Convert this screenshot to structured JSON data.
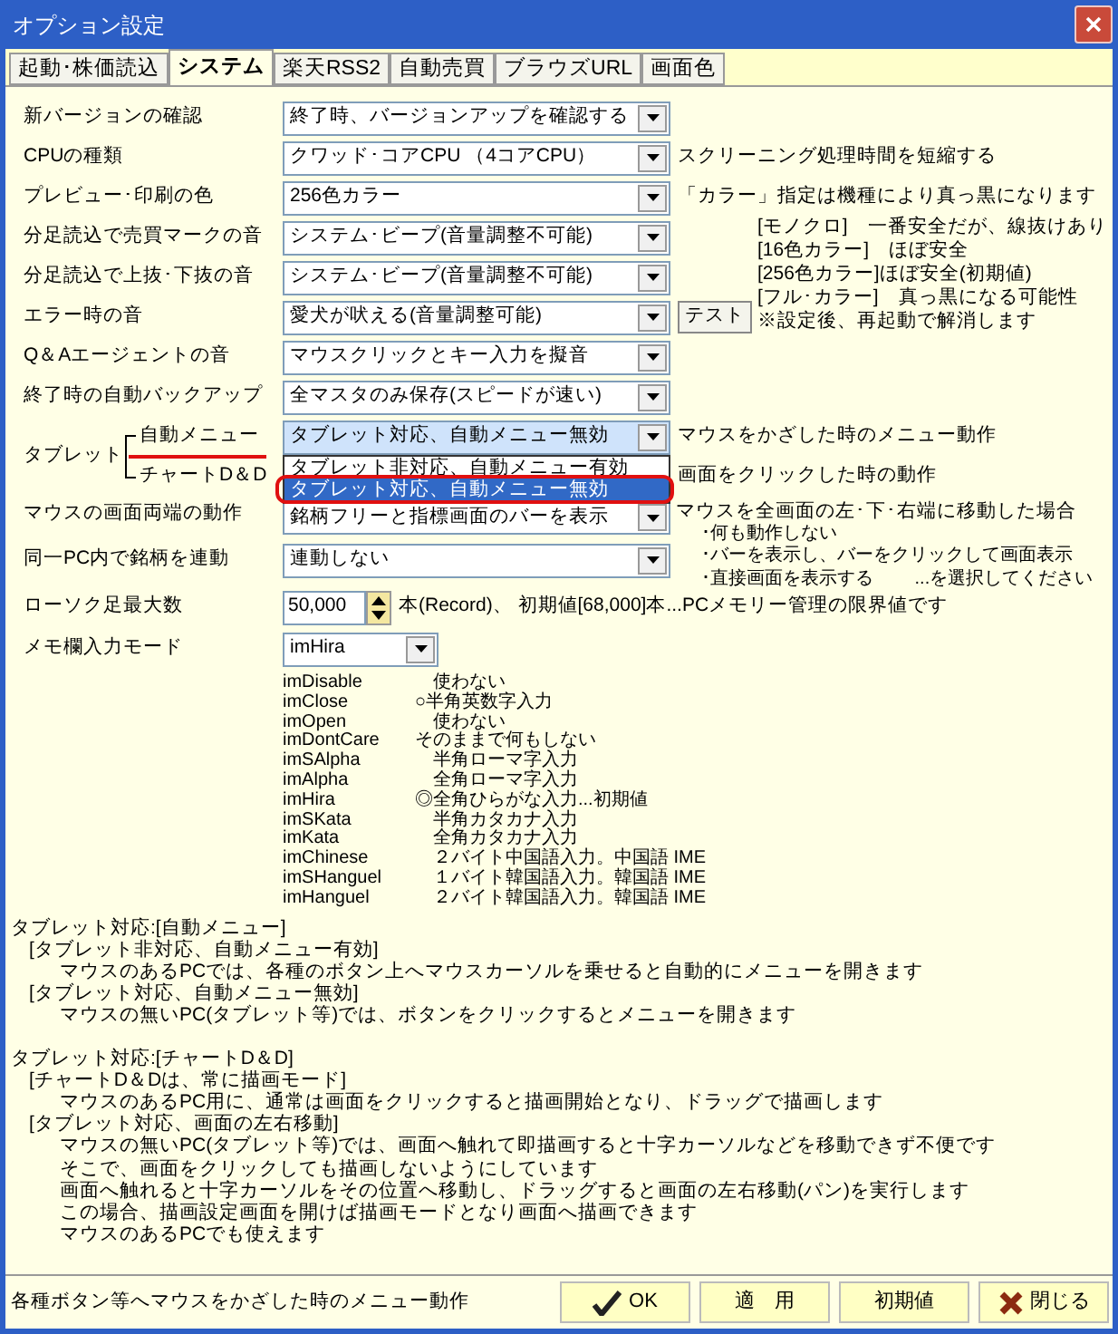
{
  "window": {
    "title": "オプション設定"
  },
  "tabs": [
    {
      "label": "起動･株価読込",
      "selected": false
    },
    {
      "label": "システム",
      "selected": true
    },
    {
      "label": "楽天RSS2",
      "selected": false
    },
    {
      "label": "自動売買",
      "selected": false
    },
    {
      "label": "ブラウズURL",
      "selected": false
    },
    {
      "label": "画面色",
      "selected": false
    }
  ],
  "settings": [
    {
      "label": "新バージョンの確認",
      "value": "終了時、バージョンアップを確認する"
    },
    {
      "label": "CPUの種類",
      "value": "クワッド･コアCPU （4コアCPU）",
      "note": "スクリーニング処理時間を短縮する"
    },
    {
      "label": "プレビュー･印刷の色",
      "value": "256色カラー",
      "note": "「カラー」指定は機種により真っ黒になります"
    }
  ],
  "sound_group": {
    "rows": [
      {
        "label": "分足読込で売買マークの音",
        "value": "システム･ビープ(音量調整不可能)"
      },
      {
        "label": "分足読込で上抜･下抜の音",
        "value": "システム･ビープ(音量調整不可能)"
      },
      {
        "label": "エラー時の音",
        "value": "愛犬が吠える(音量調整可能)",
        "button": "テスト"
      }
    ],
    "note_lines": [
      "[モノクロ]　一番安全だが、線抜けあり",
      "[16色カラー]　ほぼ安全",
      "[256色カラー]ほぼ安全(初期値)",
      "[フル･カラー]　真っ黒になる可能性",
      "※設定後、再起動で解消します"
    ]
  },
  "settings_2": [
    {
      "label": "Q＆Aエージェントの音",
      "value": "マウスクリックとキー入力を擬音"
    },
    {
      "label": "終了時の自動バックアップ",
      "value": "全マスタのみ保存(スピードが速い)"
    }
  ],
  "tablet": {
    "label": "タブレット",
    "items": [
      {
        "label": "自動メニュー",
        "value": "タブレット対応、自動メニュー無効",
        "note": "マウスをかざした時のメニュー動作",
        "expanded": true,
        "options": [
          {
            "label": "タブレット非対応、自動メニュー有効",
            "selected": false
          },
          {
            "label": "タブレット対応、自動メニュー無効",
            "selected": true
          }
        ]
      },
      {
        "label": "チャートD＆D",
        "note": "画面をクリックした時の動作"
      }
    ]
  },
  "mouse_edge": {
    "label": "マウスの画面両端の動作",
    "value": "銘柄フリーと指標画面のバーを表示",
    "note_lines": [
      "マウスを全画面の左･下･右端に移動した場合",
      "･何も動作しない",
      "･バーを表示し、バーをクリックして画面表示",
      "･直接画面を表示する　　 ...を選択してください"
    ]
  },
  "link": {
    "label": "同一PC内で銘柄を連動",
    "value": "連動しない"
  },
  "candles": {
    "label": "ローソク足最大数",
    "value": "50,000",
    "note": "本(Record)、 初期値[68,000]本...PCメモリー管理の限界値です"
  },
  "memo": {
    "label": "メモ欄入力モード",
    "value": "imHira",
    "modes": [
      {
        "name": "imDisable",
        "desc": "　使わない"
      },
      {
        "name": "imClose",
        "desc": "○半角英数字入力"
      },
      {
        "name": "imOpen",
        "desc": "　使わない"
      },
      {
        "name": "imDontCare",
        "desc": "そのままで何もしない"
      },
      {
        "name": "imSAlpha",
        "desc": "　半角ローマ字入力"
      },
      {
        "name": "imAlpha",
        "desc": "　全角ローマ字入力"
      },
      {
        "name": "imHira",
        "desc": "◎全角ひらがな入力...初期値"
      },
      {
        "name": "imSKata",
        "desc": "　半角カタカナ入力"
      },
      {
        "name": "imKata",
        "desc": "　全角カタカナ入力"
      },
      {
        "name": "imChinese",
        "desc": "　２バイト中国語入力。中国語 IME"
      },
      {
        "name": "imSHanguel",
        "desc": "　１バイト韓国語入力。韓国語 IME"
      },
      {
        "name": "imHanguel",
        "desc": "　２バイト韓国語入力。韓国語 IME"
      }
    ]
  },
  "help": [
    {
      "kind": "heading",
      "text": "タブレット対応:[自動メニュー]"
    },
    {
      "kind": "sub",
      "text": "[タブレット非対応、自動メニュー有効]"
    },
    {
      "kind": "body",
      "text": "マウスのあるPCでは、各種のボタン上へマウスカーソルを乗せると自動的にメニューを開きます"
    },
    {
      "kind": "sub",
      "text": "[タブレット対応、自動メニュー無効]"
    },
    {
      "kind": "body",
      "text": "マウスの無いPC(タブレット等)では、ボタンをクリックするとメニューを開きます"
    },
    {
      "kind": "gap"
    },
    {
      "kind": "heading",
      "text": "タブレット対応:[チャートD＆D]"
    },
    {
      "kind": "sub",
      "text": "[チャートD＆Dは、常に描画モード]"
    },
    {
      "kind": "body",
      "text": "マウスのあるPC用に、通常は画面をクリックすると描画開始となり、ドラッグで描画します"
    },
    {
      "kind": "sub",
      "text": "[タブレット対応、画面の左右移動]"
    },
    {
      "kind": "body",
      "text": "マウスの無いPC(タブレット等)では、画面へ触れて即描画すると十字カーソルなどを移動できず不便です"
    },
    {
      "kind": "body",
      "text": "そこで、画面をクリックしても描画しないようにしています"
    },
    {
      "kind": "body",
      "text": "画面へ触れると十字カーソルをその位置へ移動し、ドラッグすると画面の左右移動(パン)を実行します"
    },
    {
      "kind": "body",
      "text": "この場合、描画設定画面を開けば描画モードとなり画面へ描画できます"
    },
    {
      "kind": "body",
      "text": "マウスのあるPCでも使えます"
    }
  ],
  "status_bar": {
    "text": "各種ボタン等へマウスをかざした時のメニュー動作",
    "buttons": [
      {
        "label": "OK",
        "kind": "check"
      },
      {
        "label": "適　用",
        "kind": "plain"
      },
      {
        "label": "初期値",
        "kind": "plain"
      },
      {
        "label": "閉じる",
        "kind": "cross"
      }
    ]
  }
}
